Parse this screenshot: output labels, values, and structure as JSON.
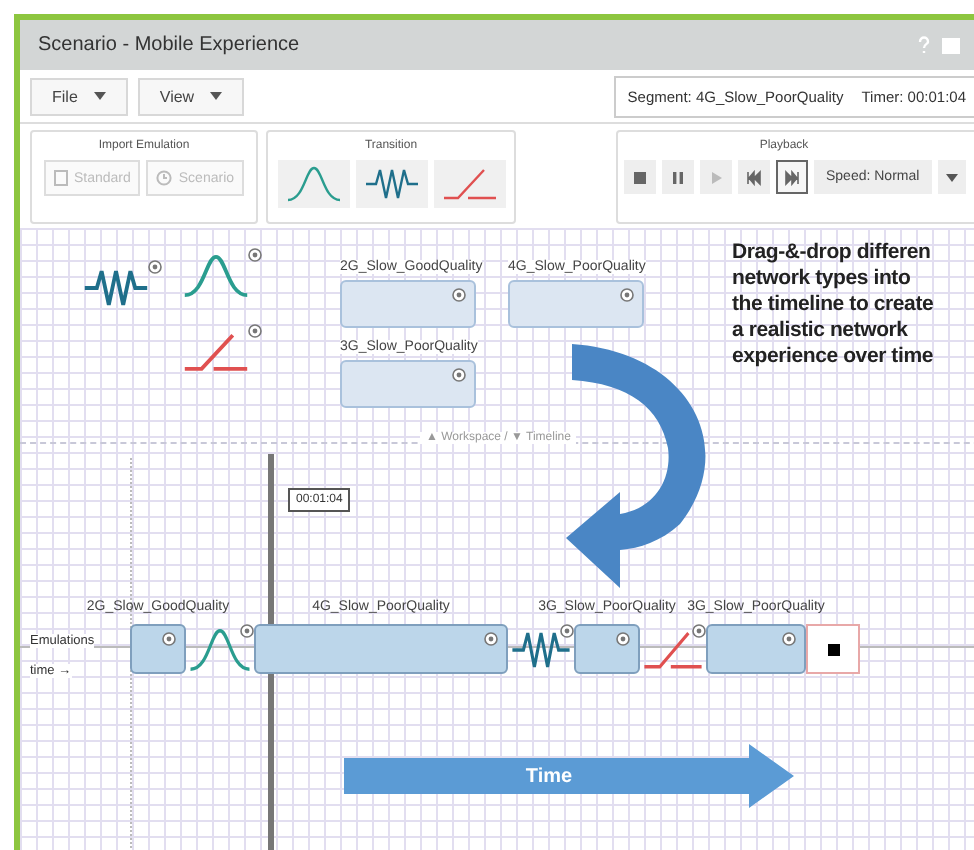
{
  "window": {
    "title": "Scenario - Mobile Experience"
  },
  "menus": [
    {
      "label": "File"
    },
    {
      "label": "View"
    }
  ],
  "status": {
    "segment": "Segment: 4G_Slow_PoorQuality",
    "timer": "Timer: 00:01:04"
  },
  "import_panel": {
    "title": "Import Emulation",
    "buttons": [
      {
        "label": "Standard",
        "kind": "file",
        "disabled": true
      },
      {
        "label": "Scenario",
        "kind": "clock",
        "disabled": true
      }
    ]
  },
  "transition_panel": {
    "title": "Transition",
    "items": [
      {
        "kind": "bell"
      },
      {
        "kind": "zigzag"
      },
      {
        "kind": "ramp"
      }
    ]
  },
  "playback_panel": {
    "title": "Playback",
    "controls": [
      {
        "kind": "stop",
        "disabled": false,
        "selected": false
      },
      {
        "kind": "pause",
        "disabled": false,
        "selected": false
      },
      {
        "kind": "play",
        "disabled": true,
        "selected": false
      },
      {
        "kind": "rewind",
        "disabled": false,
        "selected": false
      },
      {
        "kind": "forward",
        "disabled": false,
        "selected": true
      }
    ],
    "speed": "Speed: Normal"
  },
  "workspace": {
    "transitions": [
      {
        "kind": "zigzag"
      },
      {
        "kind": "bell"
      },
      {
        "kind": "ramp"
      }
    ],
    "emulations": [
      {
        "label": "2G_Slow_GoodQuality"
      },
      {
        "label": "4G_Slow_PoorQuality"
      },
      {
        "label": "3G_Slow_PoorQuality"
      }
    ]
  },
  "callout": [
    "Drag-&-drop differen",
    "network types into",
    "the timeline to create",
    "a realistic network",
    "experience over time"
  ],
  "divider": "▲ Workspace / ▼ Timeline",
  "timeline": {
    "cursor_time": "00:01:04",
    "row_labels": [
      "Emulations",
      "time →"
    ],
    "segments": [
      {
        "kind": "emulation",
        "label": "2G_Slow_GoodQuality"
      },
      {
        "kind": "bell"
      },
      {
        "kind": "emulation",
        "label": "4G_Slow_PoorQuality"
      },
      {
        "kind": "zigzag"
      },
      {
        "kind": "emulation",
        "label": "3G_Slow_PoorQuality"
      },
      {
        "kind": "ramp"
      },
      {
        "kind": "emulation",
        "label": "3G_Slow_PoorQuality"
      },
      {
        "kind": "end"
      }
    ]
  },
  "time_arrow": "Time"
}
